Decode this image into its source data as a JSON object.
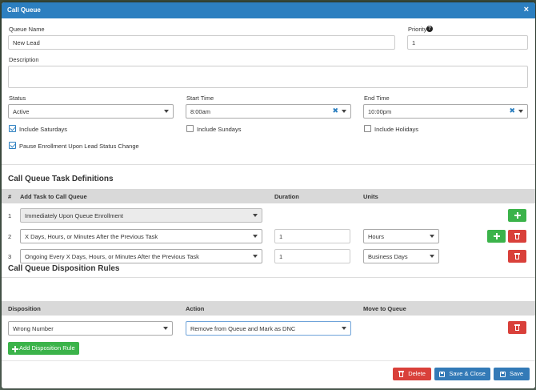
{
  "modal": {
    "title": "Call Queue",
    "close_icon": "×"
  },
  "form": {
    "queue_name_label": "Queue Name",
    "queue_name_value": "New Lead",
    "priority_label": "Priority",
    "priority_value": "1",
    "description_label": "Description",
    "description_value": "",
    "status_label": "Status",
    "status_value": "Active",
    "start_time_label": "Start Time",
    "start_time_value": "8:00am",
    "end_time_label": "End Time",
    "end_time_value": "10:00pm",
    "checkboxes": {
      "include_saturdays": {
        "label": "Include Saturdays",
        "checked": true
      },
      "include_sundays": {
        "label": "Include Sundays",
        "checked": false
      },
      "include_holidays": {
        "label": "Include Holidays",
        "checked": false
      },
      "pause_enrollment": {
        "label": "Pause Enrollment Upon Lead Status Change",
        "checked": true
      }
    }
  },
  "tasks": {
    "section_title": "Call Queue Task Definitions",
    "headers": {
      "num": "#",
      "task": "Add Task to Call Queue",
      "duration": "Duration",
      "units": "Units"
    },
    "rows": [
      {
        "num": "1",
        "task": "Immediately Upon Queue Enrollment",
        "duration": "",
        "units": ""
      },
      {
        "num": "2",
        "task": "X Days, Hours, or Minutes After the Previous Task",
        "duration": "1",
        "units": "Hours"
      },
      {
        "num": "3",
        "task": "Ongoing Every X Days, Hours, or Minutes After the Previous Task",
        "duration": "1",
        "units": "Business Days"
      }
    ]
  },
  "disposition": {
    "section_title": "Call Queue Disposition Rules",
    "headers": {
      "disposition": "Disposition",
      "action": "Action",
      "move_to_queue": "Move to Queue"
    },
    "rows": [
      {
        "disposition": "Wrong Number",
        "action": "Remove from Queue and Mark as DNC"
      }
    ],
    "add_rule_label": "Add Disposition Rule"
  },
  "footer": {
    "delete_label": "Delete",
    "save_close_label": "Save & Close",
    "save_label": "Save"
  },
  "colors": {
    "header_blue": "#2c7fc0",
    "add_green": "#3bb34a",
    "delete_red": "#d9403a",
    "save_blue": "#337ab7"
  }
}
